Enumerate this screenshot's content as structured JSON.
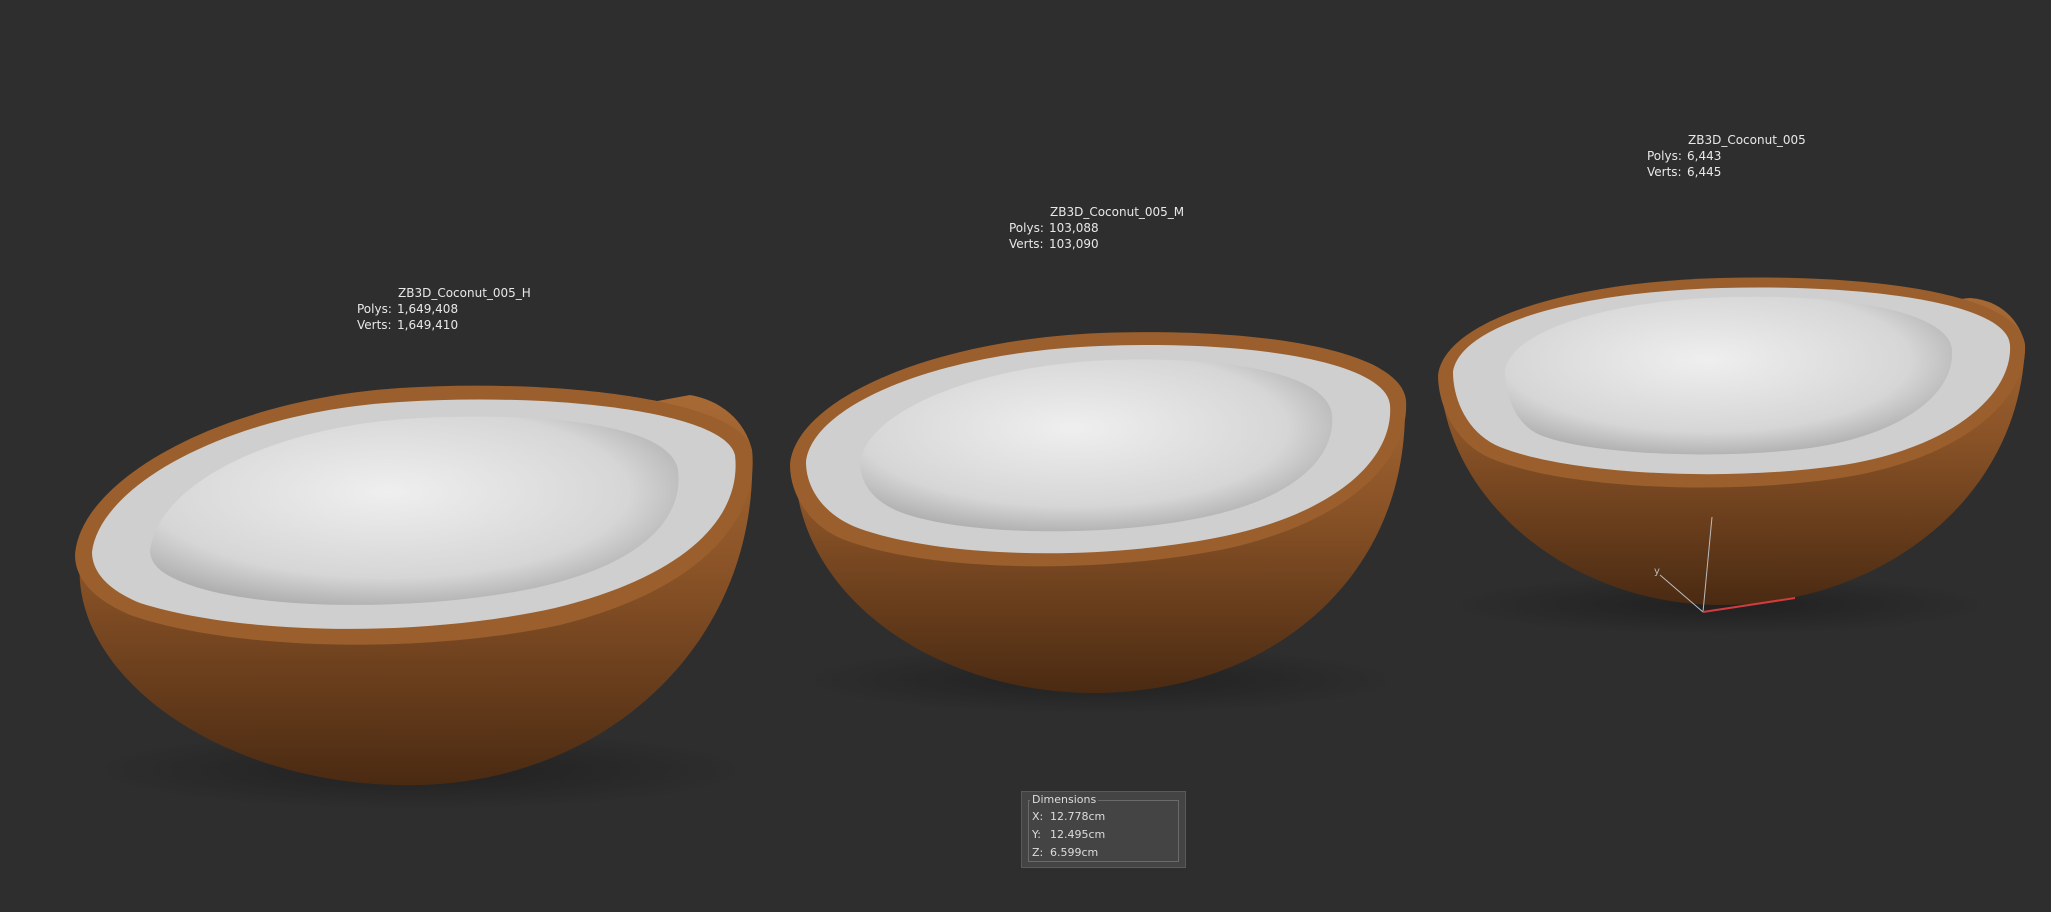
{
  "scene": {
    "background": "#2e2e2e",
    "objects": [
      {
        "name": "ZB3D_Coconut_005_H",
        "polys_label": "Polys:",
        "polys": "1,649,408",
        "verts_label": "Verts:",
        "verts": "1,649,410"
      },
      {
        "name": "ZB3D_Coconut_005_M",
        "polys_label": "Polys:",
        "polys": "103,088",
        "verts_label": "Verts:",
        "verts": "103,090"
      },
      {
        "name": "ZB3D_Coconut_005",
        "polys_label": "Polys:",
        "polys": "6,443",
        "verts_label": "Verts:",
        "verts": "6,445"
      }
    ],
    "gizmo_axis_label": "y",
    "colors": {
      "shell_outer": "#8a5327",
      "shell_dark": "#4a2a12",
      "flesh": "#d9d9d9",
      "gizmo_x": "#d23c3c",
      "gizmo_y": "#bdbdbd"
    }
  },
  "dimensions": {
    "title": "Dimensions",
    "x_label": "X:",
    "x": "12.778cm",
    "y_label": "Y:",
    "y": "12.495cm",
    "z_label": "Z:",
    "z": "6.599cm"
  }
}
